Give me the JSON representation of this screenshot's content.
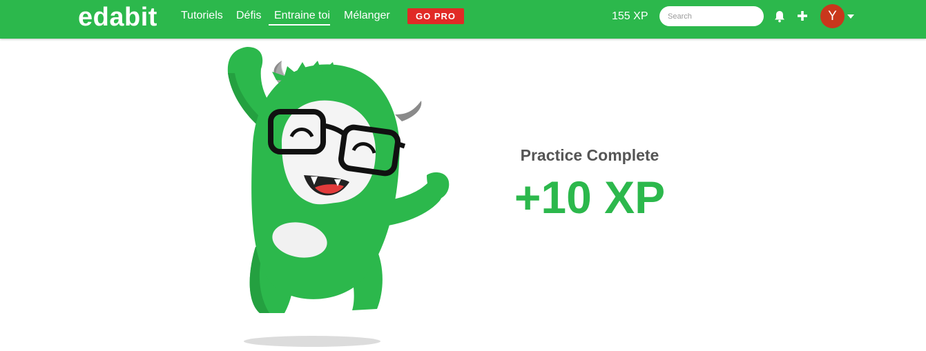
{
  "brand": {
    "logo": "edabit"
  },
  "nav": {
    "links": [
      {
        "label": "Tutoriels"
      },
      {
        "label": "Défis"
      },
      {
        "label": "Entraine toi"
      },
      {
        "label": "Mélanger"
      }
    ],
    "gopro_label": "GO PRO",
    "xp_label": "155 XP",
    "search_placeholder": "Search",
    "avatar_initial": "Y",
    "icons": [
      "bell-icon",
      "plus-icon",
      "caret-down-icon"
    ],
    "colors": {
      "brand_green": "#2cb84c",
      "gopro_red": "#e12a26",
      "avatar_red": "#c9371c"
    }
  },
  "result": {
    "title": "Practice Complete",
    "xp_gain": "+10 XP"
  }
}
